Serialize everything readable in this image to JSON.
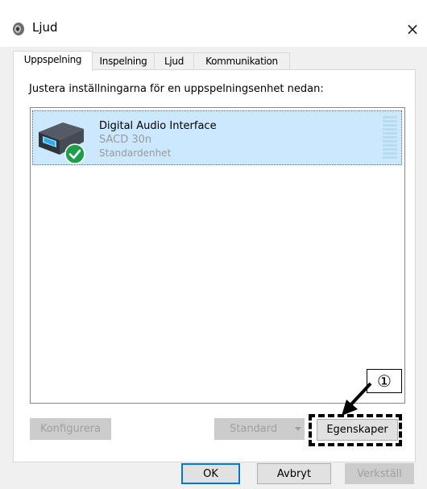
{
  "window": {
    "title": "Ljud",
    "close_glyph": "×"
  },
  "tabs": [
    {
      "label": "Uppspelning",
      "active": true
    },
    {
      "label": "Inspelning",
      "active": false
    },
    {
      "label": "Ljud",
      "active": false
    },
    {
      "label": "Kommunikation",
      "active": false
    }
  ],
  "instruction": "Justera inställningarna för en uppspelningsenhet nedan:",
  "devices": [
    {
      "name": "Digital Audio Interface",
      "model": "SACD 30n",
      "status": "Standardenhet",
      "selected": true,
      "icon": "audio-device-icon",
      "badge": "default-checkmark-icon"
    }
  ],
  "panel_buttons": {
    "configure": "Konfigurera",
    "set_default": "Standard",
    "properties": "Egenskaper"
  },
  "dialog_buttons": {
    "ok": "OK",
    "cancel": "Avbryt",
    "apply": "Verkställ"
  },
  "callout": {
    "number": "①"
  },
  "colors": {
    "selection": "#cce8ff",
    "accent": "#0078d7",
    "check_badge": "#1e9e4a"
  }
}
